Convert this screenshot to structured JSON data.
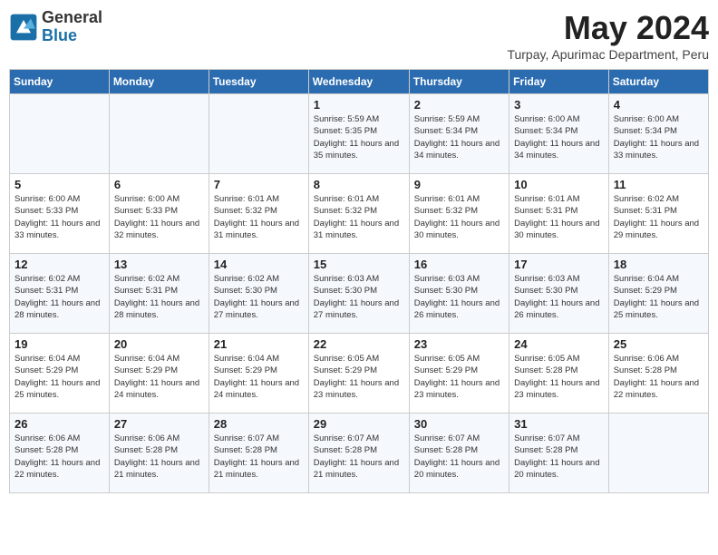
{
  "header": {
    "logo_general": "General",
    "logo_blue": "Blue",
    "month_title": "May 2024",
    "subtitle": "Turpay, Apurimac Department, Peru"
  },
  "days_of_week": [
    "Sunday",
    "Monday",
    "Tuesday",
    "Wednesday",
    "Thursday",
    "Friday",
    "Saturday"
  ],
  "weeks": [
    [
      {
        "day": "",
        "info": ""
      },
      {
        "day": "",
        "info": ""
      },
      {
        "day": "",
        "info": ""
      },
      {
        "day": "1",
        "info": "Sunrise: 5:59 AM\nSunset: 5:35 PM\nDaylight: 11 hours and 35 minutes."
      },
      {
        "day": "2",
        "info": "Sunrise: 5:59 AM\nSunset: 5:34 PM\nDaylight: 11 hours and 34 minutes."
      },
      {
        "day": "3",
        "info": "Sunrise: 6:00 AM\nSunset: 5:34 PM\nDaylight: 11 hours and 34 minutes."
      },
      {
        "day": "4",
        "info": "Sunrise: 6:00 AM\nSunset: 5:34 PM\nDaylight: 11 hours and 33 minutes."
      }
    ],
    [
      {
        "day": "5",
        "info": "Sunrise: 6:00 AM\nSunset: 5:33 PM\nDaylight: 11 hours and 33 minutes."
      },
      {
        "day": "6",
        "info": "Sunrise: 6:00 AM\nSunset: 5:33 PM\nDaylight: 11 hours and 32 minutes."
      },
      {
        "day": "7",
        "info": "Sunrise: 6:01 AM\nSunset: 5:32 PM\nDaylight: 11 hours and 31 minutes."
      },
      {
        "day": "8",
        "info": "Sunrise: 6:01 AM\nSunset: 5:32 PM\nDaylight: 11 hours and 31 minutes."
      },
      {
        "day": "9",
        "info": "Sunrise: 6:01 AM\nSunset: 5:32 PM\nDaylight: 11 hours and 30 minutes."
      },
      {
        "day": "10",
        "info": "Sunrise: 6:01 AM\nSunset: 5:31 PM\nDaylight: 11 hours and 30 minutes."
      },
      {
        "day": "11",
        "info": "Sunrise: 6:02 AM\nSunset: 5:31 PM\nDaylight: 11 hours and 29 minutes."
      }
    ],
    [
      {
        "day": "12",
        "info": "Sunrise: 6:02 AM\nSunset: 5:31 PM\nDaylight: 11 hours and 28 minutes."
      },
      {
        "day": "13",
        "info": "Sunrise: 6:02 AM\nSunset: 5:31 PM\nDaylight: 11 hours and 28 minutes."
      },
      {
        "day": "14",
        "info": "Sunrise: 6:02 AM\nSunset: 5:30 PM\nDaylight: 11 hours and 27 minutes."
      },
      {
        "day": "15",
        "info": "Sunrise: 6:03 AM\nSunset: 5:30 PM\nDaylight: 11 hours and 27 minutes."
      },
      {
        "day": "16",
        "info": "Sunrise: 6:03 AM\nSunset: 5:30 PM\nDaylight: 11 hours and 26 minutes."
      },
      {
        "day": "17",
        "info": "Sunrise: 6:03 AM\nSunset: 5:30 PM\nDaylight: 11 hours and 26 minutes."
      },
      {
        "day": "18",
        "info": "Sunrise: 6:04 AM\nSunset: 5:29 PM\nDaylight: 11 hours and 25 minutes."
      }
    ],
    [
      {
        "day": "19",
        "info": "Sunrise: 6:04 AM\nSunset: 5:29 PM\nDaylight: 11 hours and 25 minutes."
      },
      {
        "day": "20",
        "info": "Sunrise: 6:04 AM\nSunset: 5:29 PM\nDaylight: 11 hours and 24 minutes."
      },
      {
        "day": "21",
        "info": "Sunrise: 6:04 AM\nSunset: 5:29 PM\nDaylight: 11 hours and 24 minutes."
      },
      {
        "day": "22",
        "info": "Sunrise: 6:05 AM\nSunset: 5:29 PM\nDaylight: 11 hours and 23 minutes."
      },
      {
        "day": "23",
        "info": "Sunrise: 6:05 AM\nSunset: 5:29 PM\nDaylight: 11 hours and 23 minutes."
      },
      {
        "day": "24",
        "info": "Sunrise: 6:05 AM\nSunset: 5:28 PM\nDaylight: 11 hours and 23 minutes."
      },
      {
        "day": "25",
        "info": "Sunrise: 6:06 AM\nSunset: 5:28 PM\nDaylight: 11 hours and 22 minutes."
      }
    ],
    [
      {
        "day": "26",
        "info": "Sunrise: 6:06 AM\nSunset: 5:28 PM\nDaylight: 11 hours and 22 minutes."
      },
      {
        "day": "27",
        "info": "Sunrise: 6:06 AM\nSunset: 5:28 PM\nDaylight: 11 hours and 21 minutes."
      },
      {
        "day": "28",
        "info": "Sunrise: 6:07 AM\nSunset: 5:28 PM\nDaylight: 11 hours and 21 minutes."
      },
      {
        "day": "29",
        "info": "Sunrise: 6:07 AM\nSunset: 5:28 PM\nDaylight: 11 hours and 21 minutes."
      },
      {
        "day": "30",
        "info": "Sunrise: 6:07 AM\nSunset: 5:28 PM\nDaylight: 11 hours and 20 minutes."
      },
      {
        "day": "31",
        "info": "Sunrise: 6:07 AM\nSunset: 5:28 PM\nDaylight: 11 hours and 20 minutes."
      },
      {
        "day": "",
        "info": ""
      }
    ]
  ]
}
